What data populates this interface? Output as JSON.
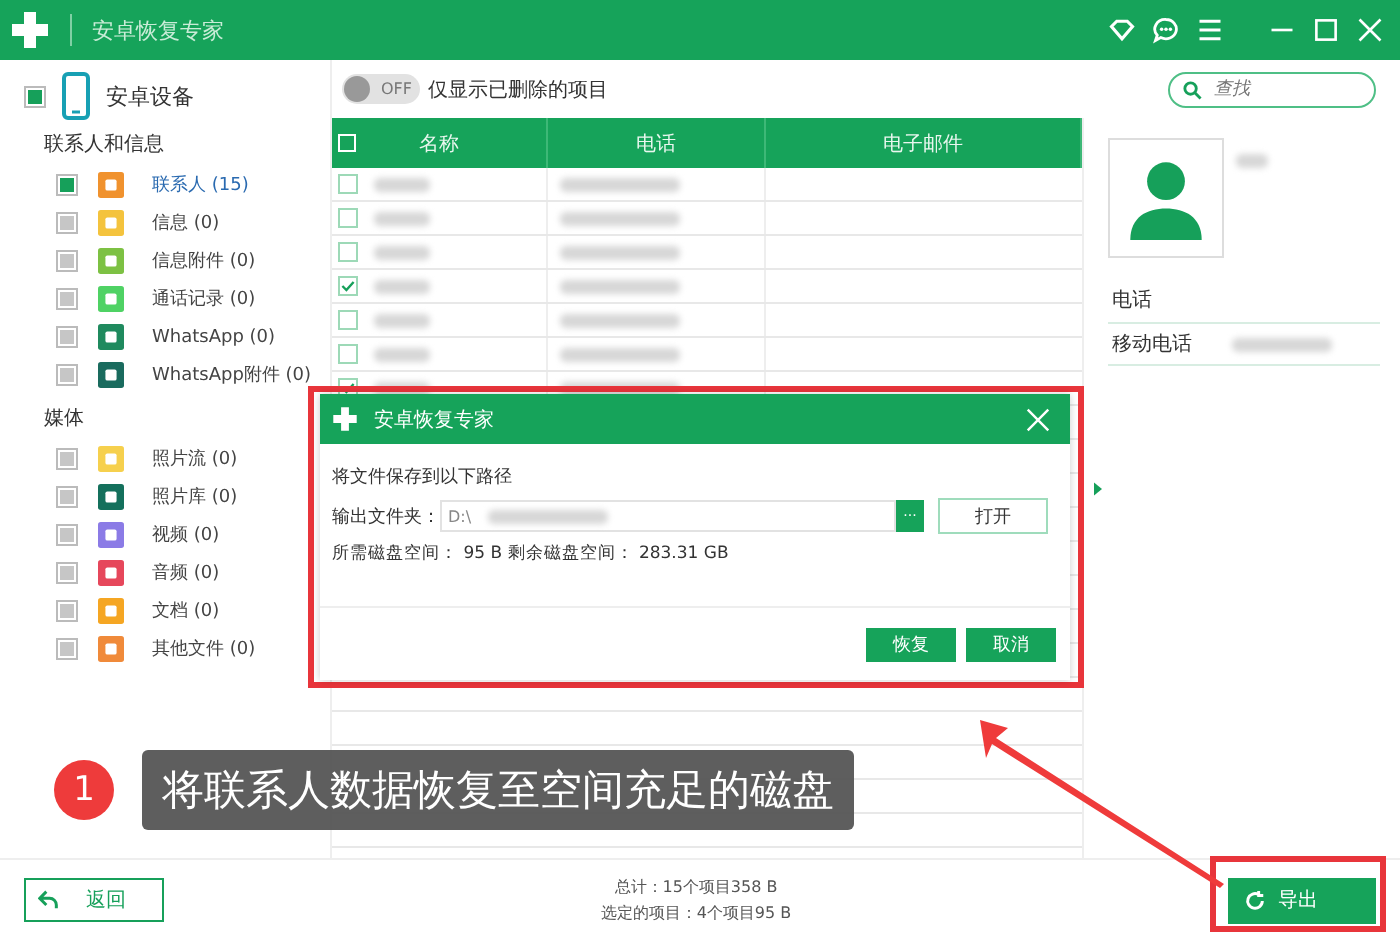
{
  "window": {
    "title": "安卓恢复专家"
  },
  "sidebar": {
    "device": {
      "label": "安卓设备",
      "checked": true
    },
    "groups": [
      {
        "title": "联系人和信息",
        "items": [
          {
            "label": "联系人 (15)",
            "checked": true,
            "selected": true,
            "color": "#f0922e"
          },
          {
            "label": "信息 (0)",
            "checked": false,
            "selected": false,
            "color": "#f4c33d"
          },
          {
            "label": "信息附件 (0)",
            "checked": false,
            "selected": false,
            "color": "#7dc143"
          },
          {
            "label": "通话记录 (0)",
            "checked": false,
            "selected": false,
            "color": "#4fd264"
          },
          {
            "label": "WhatsApp (0)",
            "checked": false,
            "selected": false,
            "color": "#1f8a5e"
          },
          {
            "label": "WhatsApp附件 (0)",
            "checked": false,
            "selected": false,
            "color": "#1a6b5e"
          }
        ]
      },
      {
        "title": "媒体",
        "items": [
          {
            "label": "照片流 (0)",
            "checked": false,
            "selected": false,
            "color": "#f6d04d"
          },
          {
            "label": "照片库 (0)",
            "checked": false,
            "selected": false,
            "color": "#14705c"
          },
          {
            "label": "视频 (0)",
            "checked": false,
            "selected": false,
            "color": "#8b7be6"
          },
          {
            "label": "音频 (0)",
            "checked": false,
            "selected": false,
            "color": "#e6475b"
          },
          {
            "label": "文档 (0)",
            "checked": false,
            "selected": false,
            "color": "#f5a623"
          },
          {
            "label": "其他文件 (0)",
            "checked": false,
            "selected": false,
            "color": "#f08a3a"
          }
        ]
      }
    ]
  },
  "toolbar": {
    "toggle": {
      "label": "OFF",
      "on": false
    },
    "toggle_caption": "仅显示已删除的项目",
    "search": {
      "placeholder": "查找"
    }
  },
  "table": {
    "columns": [
      "名称",
      "电话",
      "电子邮件"
    ],
    "header_checked": false,
    "rows": [
      {
        "checked": false
      },
      {
        "checked": false
      },
      {
        "checked": false
      },
      {
        "checked": true
      },
      {
        "checked": false
      },
      {
        "checked": false
      },
      {
        "checked": true
      }
    ]
  },
  "detail": {
    "section": "电话",
    "field_label": "移动电话"
  },
  "dialog": {
    "title": "安卓恢复专家",
    "heading": "将文件保存到以下路径",
    "folder_label": "输出文件夹：",
    "folder_value": "D:\\",
    "browse": "···",
    "open": "打开",
    "disk_info": "所需磁盘空间： 95 B 剩余磁盘空间： 283.31 GB",
    "buttons": [
      "恢复",
      "取消"
    ]
  },
  "annotation": {
    "number": "1",
    "text": "将联系人数据恢复至空间充足的磁盘"
  },
  "footer": {
    "back": "返回",
    "summary": [
      "总计：15个项目358 B",
      "选定的项目：4个项目95 B"
    ],
    "export": "导出"
  }
}
